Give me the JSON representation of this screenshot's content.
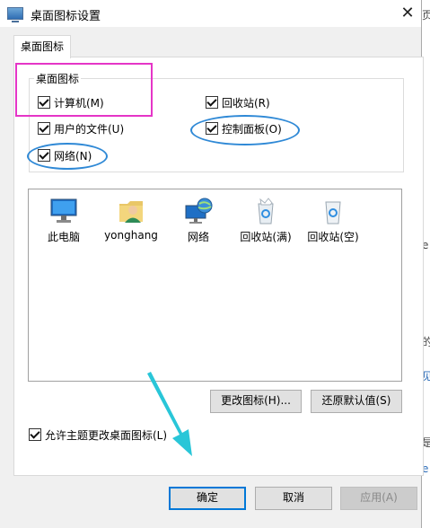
{
  "window": {
    "title": "桌面图标设置",
    "close_glyph": "✕"
  },
  "tabs": [
    {
      "label": "桌面图标"
    }
  ],
  "group": {
    "label": "桌面图标",
    "checkboxes": [
      {
        "label": "计算机(M)",
        "checked": true
      },
      {
        "label": "回收站(R)",
        "checked": true
      },
      {
        "label": "用户的文件(U)",
        "checked": true
      },
      {
        "label": "控制面板(O)",
        "checked": true
      },
      {
        "label": "网络(N)",
        "checked": true
      }
    ]
  },
  "icons": [
    {
      "label": "此电脑",
      "icon": "this-pc-icon"
    },
    {
      "label": "yonghang",
      "icon": "user-folder-icon"
    },
    {
      "label": "网络",
      "icon": "network-icon"
    },
    {
      "label": "回收站(满)",
      "icon": "recycle-bin-full-icon"
    },
    {
      "label": "回收站(空)",
      "icon": "recycle-bin-empty-icon"
    }
  ],
  "buttons": {
    "change_icon": "更改图标(H)...",
    "restore_default": "还原默认值(S)",
    "ok": "确定",
    "cancel": "取消",
    "apply": "应用(A)"
  },
  "allow_themes": {
    "label": "允许主题更改桌面图标(L)",
    "checked": true
  },
  "background": {
    "glyphs": [
      "页",
      "e",
      "的",
      "见",
      "是",
      "e"
    ]
  },
  "colors": {
    "highlight_box": "#e535c7",
    "highlight_oval": "#2f89d6",
    "arrow": "#29c6d8",
    "accent": "#0078d7"
  }
}
